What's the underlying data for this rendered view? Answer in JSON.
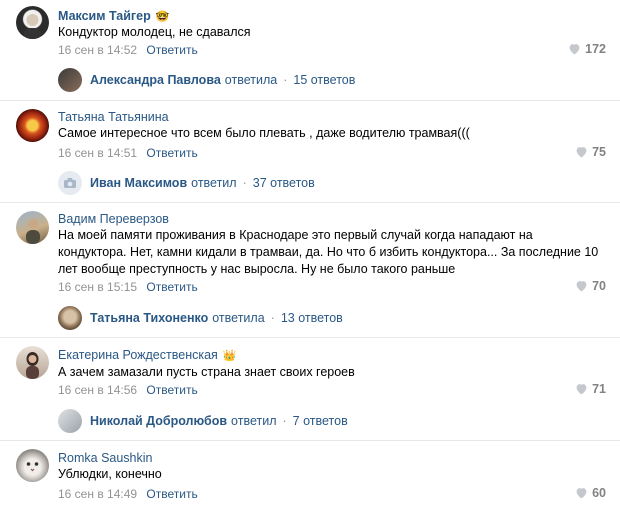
{
  "comments": [
    {
      "author": "Максим Тайгер",
      "author_badge": "🤓",
      "text": "Кондуктор молодец, не сдавался",
      "date": "16 сен в 14:52",
      "reply_label": "Ответить",
      "likes": "172",
      "thread": {
        "name": "Александра Павлова",
        "verb": "ответила",
        "count": "15 ответов"
      }
    },
    {
      "author": "Татьяна Татьянина",
      "text": "Самое интересное что всем было плевать , даже водителю трамвая(((",
      "date": "16 сен в 14:51",
      "reply_label": "Ответить",
      "likes": "75",
      "thread": {
        "name": "Иван Максимов",
        "verb": "ответил",
        "count": "37 ответов"
      }
    },
    {
      "author": "Вадим Переверзов",
      "text": "На моей памяти проживания в Краснодаре это первый случай когда нападают на кондуктора. Нет, камни кидали в трамваи, да. Но что б избить кондуктора... За последние 10 лет вообще преступность у нас выросла. Ну не было такого раньше",
      "date": "16 сен в 15:15",
      "reply_label": "Ответить",
      "likes": "70",
      "thread": {
        "name": "Татьяна Тихоненко",
        "verb": "ответила",
        "count": "13 ответов"
      }
    },
    {
      "author": "Екатерина Рождественская",
      "author_badge": "👑",
      "text": "А зачем замазали пусть страна знает своих героев",
      "date": "16 сен в 14:56",
      "reply_label": "Ответить",
      "likes": "71",
      "thread": {
        "name": "Николай Добролюбов",
        "verb": "ответил",
        "count": "7 ответов"
      }
    },
    {
      "author": "Romka Saushkin",
      "text": "Ублюдки, конечно",
      "date": "16 сен в 14:49",
      "reply_label": "Ответить",
      "likes": "60"
    }
  ],
  "colors": {
    "link": "#2a5885",
    "meta": "#939393",
    "like": "#828282",
    "separator": "#e7e8ec"
  }
}
